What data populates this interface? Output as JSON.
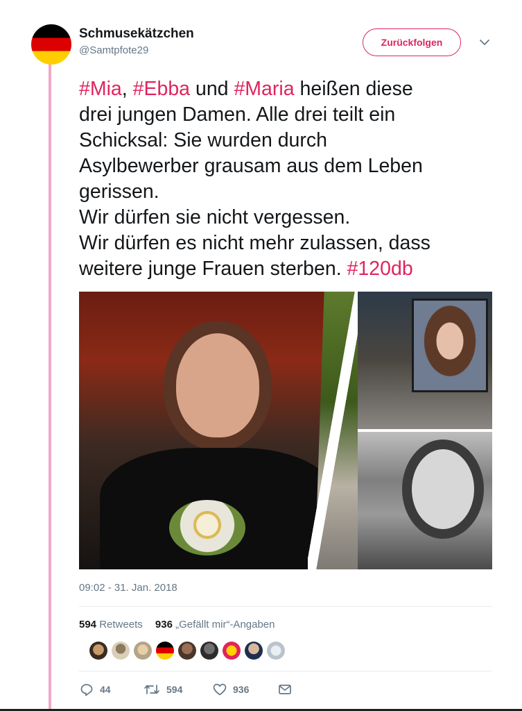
{
  "author": {
    "display_name": "Schmusekätzchen",
    "handle": "@Samtpfote29",
    "avatar_icon": "german-flag-avatar"
  },
  "follow_button": {
    "label": "Zurückfolgen"
  },
  "tweet": {
    "hashtag_mia": "#Mia",
    "sep1": ",",
    "hashtag_ebba": "#Ebba",
    "und": "und",
    "hashtag_maria": "#Maria",
    "line1_tail": "heißen diese",
    "line2": "drei jungen Damen. Alle drei teilt ein",
    "line3": "Schicksal: Sie wurden durch",
    "line4": "Asylbewerber grausam aus dem Leben",
    "line5": "gerissen.",
    "line6": "Wir dürfen sie nicht vergessen.",
    "line7": "Wir dürfen es nicht mehr zulassen, dass",
    "line8_text": "weitere junge Frauen sterben.",
    "hashtag_120db": "#120db"
  },
  "timestamp": "09:02 - 31. Jan. 2018",
  "stats": {
    "retweets_count": "594",
    "retweets_label": "Retweets",
    "likes_count": "936",
    "likes_label": "„Gefällt mir“-Angaben"
  },
  "actions": {
    "reply_count": "44",
    "retweet_count": "594",
    "like_count": "936"
  },
  "colors": {
    "accent": "#e0245e",
    "hashtag": "#e0245e",
    "thread_line": "#f1a8c9",
    "secondary_text": "#657786"
  }
}
